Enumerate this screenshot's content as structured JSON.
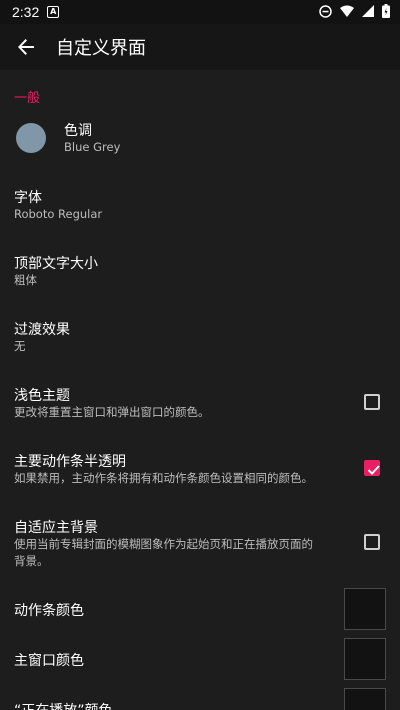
{
  "status_bar": {
    "time": "2:32",
    "notif_icon": "A"
  },
  "app_bar": {
    "title": "自定义界面"
  },
  "sections": {
    "general": "一般"
  },
  "settings": {
    "tint": {
      "title": "色调",
      "value": "Blue Grey",
      "color": "#7f97a6"
    },
    "font": {
      "title": "字体",
      "value": "Roboto Regular"
    },
    "header_size": {
      "title": "顶部文字大小",
      "value": "粗体"
    },
    "transition": {
      "title": "过渡效果",
      "value": "无"
    },
    "light_theme": {
      "title": "浅色主题",
      "summary": "更改将重置主窗口和弹出窗口的颜色。",
      "checked": false
    },
    "translucent_actionbar": {
      "title": "主要动作条半透明",
      "summary": "如果禁用，主动作条将拥有和动作条颜色设置相同的颜色。",
      "checked": true
    },
    "adaptive_bg": {
      "title": "自适应主背景",
      "summary_line1": "使用当前专辑封面的模糊图象作为起始页和正在播放页面的",
      "summary_line2": "背景。",
      "checked": false
    },
    "actionbar_color": {
      "title": "动作条颜色",
      "color": "#121212"
    },
    "main_window_color": {
      "title": "主窗口颜色",
      "color": "#121212"
    },
    "now_playing_color": {
      "title": "“正在播放”颜色",
      "color": "#121212"
    }
  },
  "colors": {
    "accent": "#e91e63",
    "background": "#1d1d1d",
    "appbar": "#161616"
  }
}
